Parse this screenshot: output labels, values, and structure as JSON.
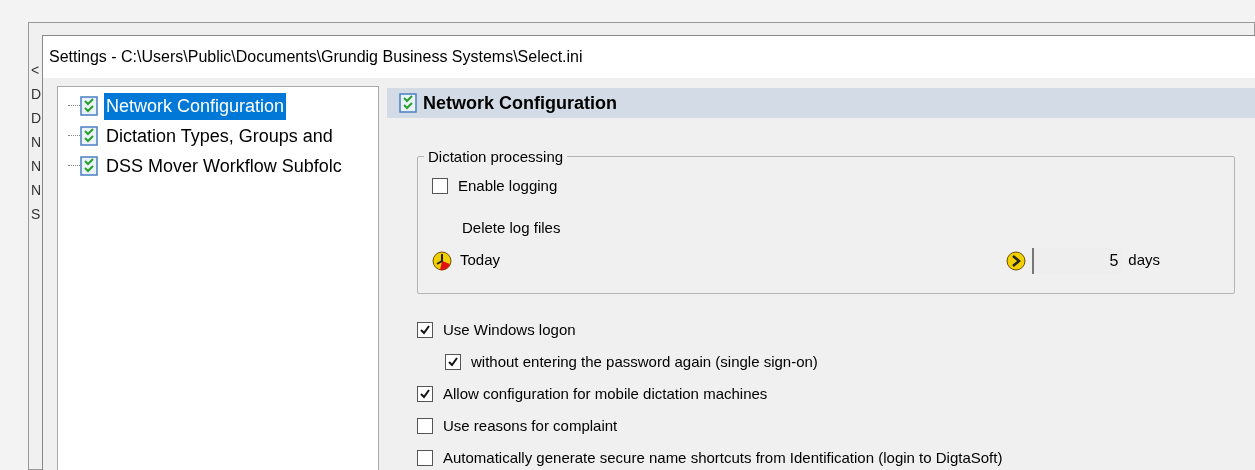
{
  "background_window": {
    "list_items": [
      "<",
      "D",
      "D",
      "N",
      "N",
      "N",
      "S"
    ]
  },
  "window": {
    "title": "Settings - C:\\Users\\Public\\Documents\\Grundig Business Systems\\Select.ini"
  },
  "tree": {
    "items": [
      {
        "label": "Network Configuration",
        "selected": true
      },
      {
        "label": "Dictation Types, Groups and",
        "selected": false
      },
      {
        "label": "DSS Mover Workflow Subfolc",
        "selected": false
      }
    ]
  },
  "page": {
    "title": "Network Configuration",
    "group": {
      "title": "Dictation processing",
      "enable_logging": {
        "label": "Enable logging",
        "checked": false
      },
      "delete_label": "Delete log files",
      "today_label": "Today",
      "days_value": "5",
      "days_unit": "days"
    },
    "options": [
      {
        "label": "Use Windows logon",
        "checked": true,
        "children": [
          {
            "label": "without entering the password again (single sign-on)",
            "checked": true
          }
        ]
      },
      {
        "label": "Allow configuration for mobile dictation machines",
        "checked": true
      },
      {
        "label": "Use reasons for complaint",
        "checked": false
      },
      {
        "label": "Automatically generate secure name shortcuts from Identification (login to DigtaSoft)",
        "checked": false
      }
    ]
  }
}
